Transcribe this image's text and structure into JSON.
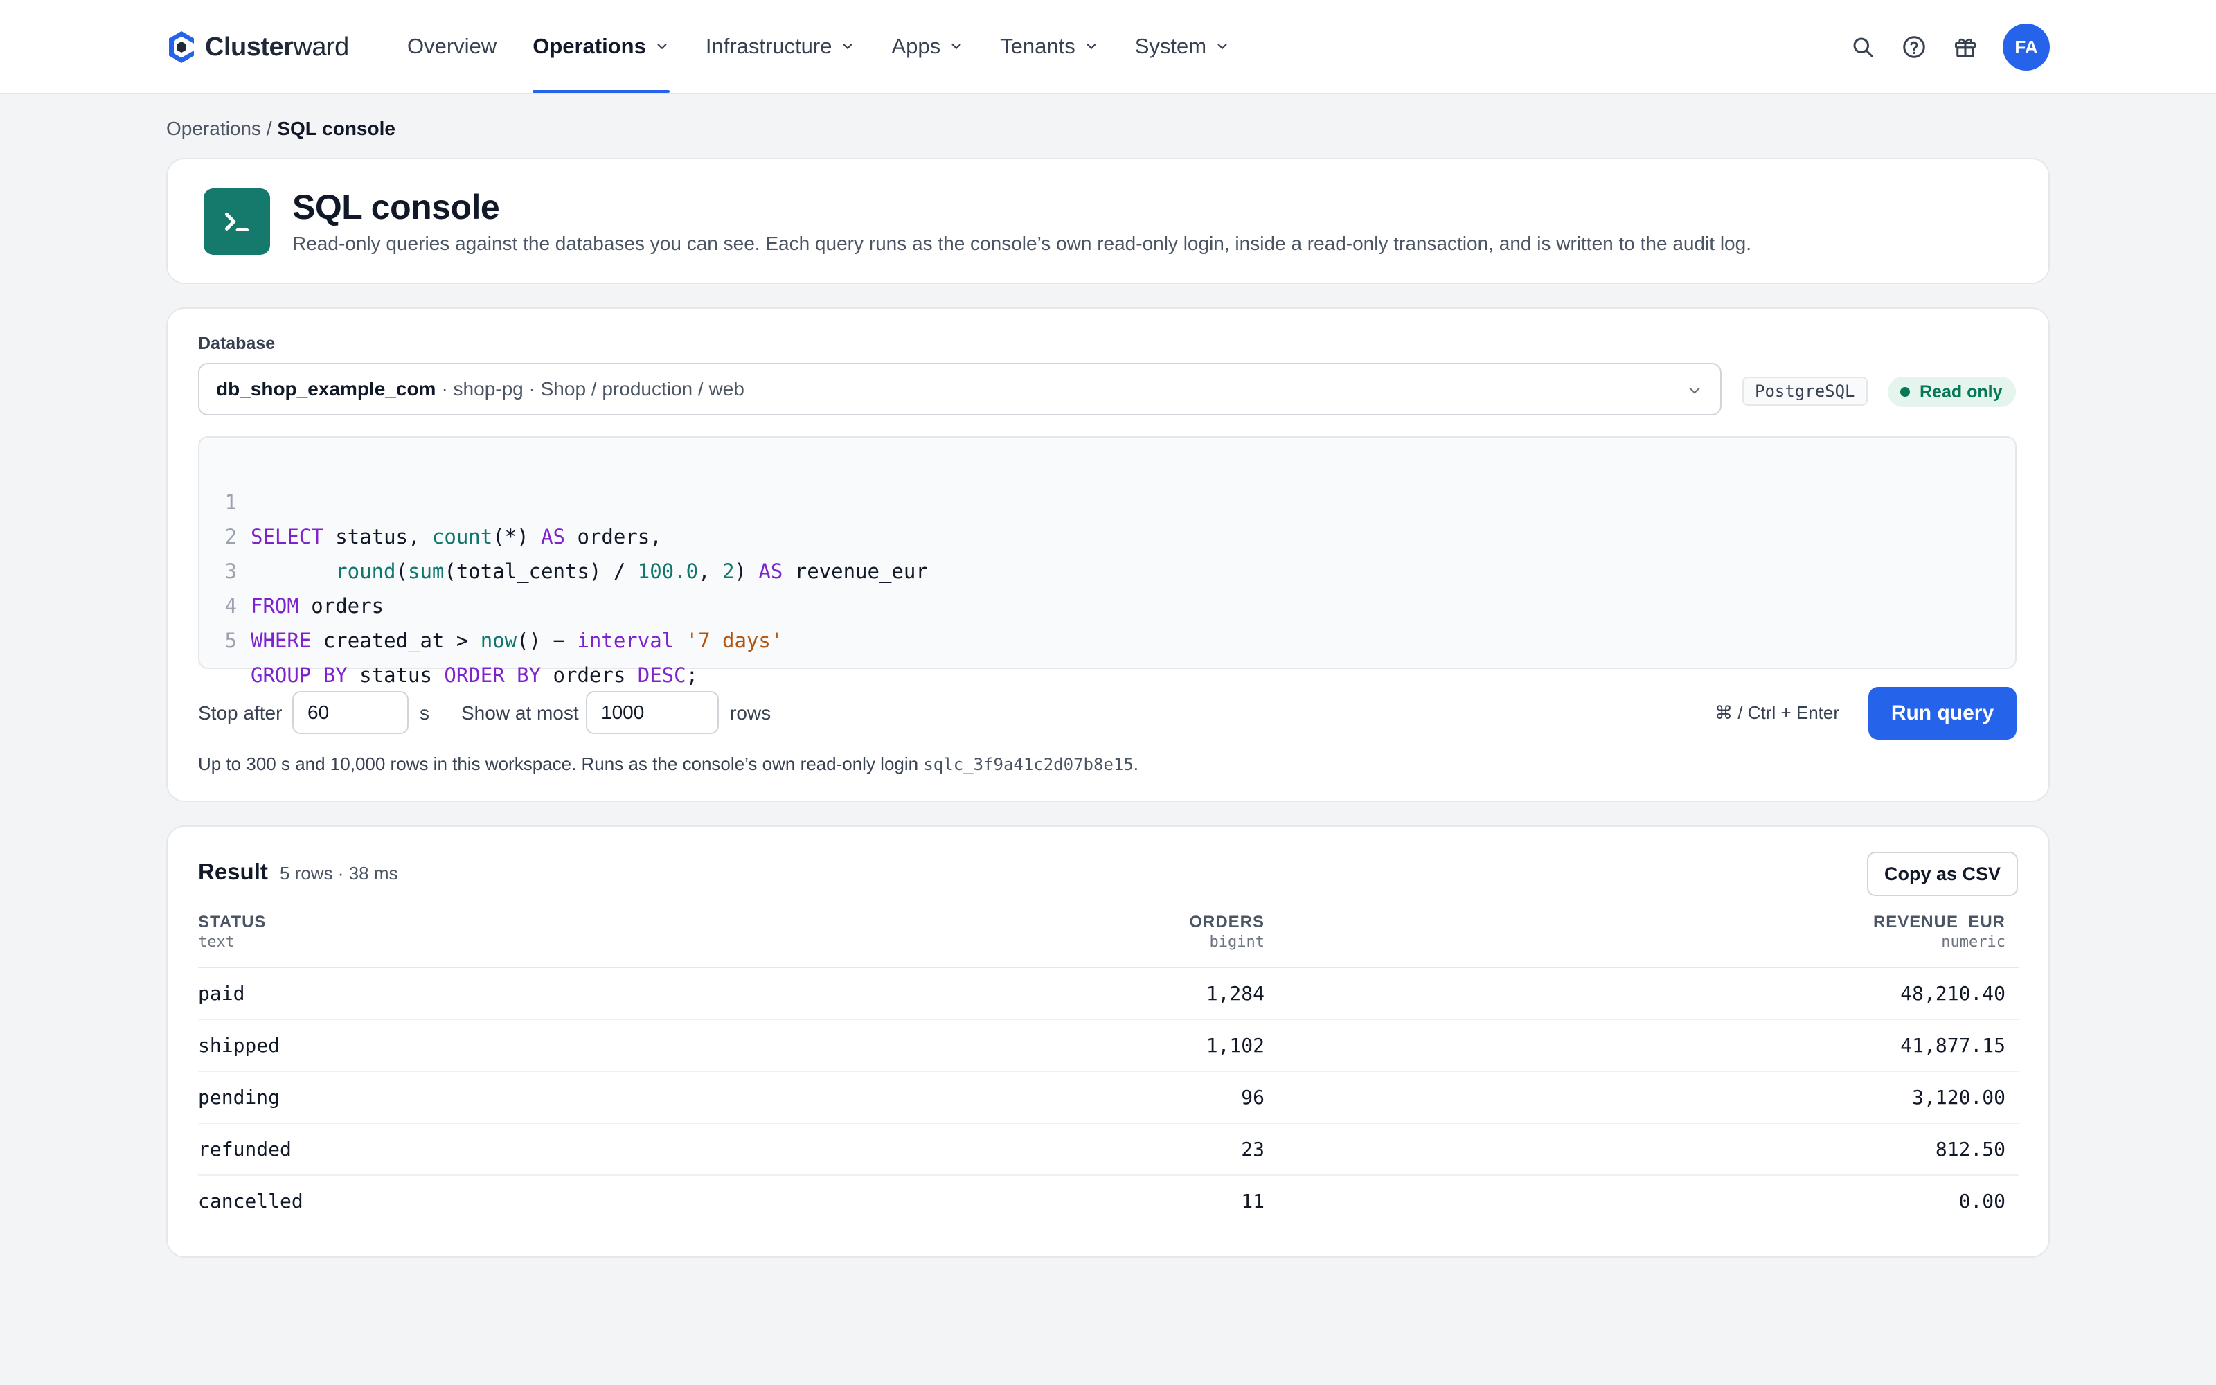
{
  "brand": {
    "name_bold": "Cluster",
    "name_light": "ward"
  },
  "nav": {
    "items": [
      {
        "label": "Overview"
      },
      {
        "label": "Operations"
      },
      {
        "label": "Infrastructure"
      },
      {
        "label": "Apps"
      },
      {
        "label": "Tenants"
      },
      {
        "label": "System"
      }
    ],
    "active": "Operations",
    "avatar_initials": "FA",
    "accent_color": "#2563eb"
  },
  "breadcrumb": {
    "parent": "Operations",
    "separator": " / ",
    "current": "SQL console"
  },
  "header": {
    "title": "SQL console",
    "description": "Read-only queries against the databases you can see. Each query runs as the console’s own read-only login, inside a read-only transaction, and is written to the audit log."
  },
  "query": {
    "database_label": "Database",
    "database_name": "db_shop_example_com",
    "database_meta": "· shop-pg · Shop / production / web",
    "engine_badge": "PostgreSQL",
    "mode_badge": "Read only",
    "code_lines": [
      "1",
      "2",
      "3",
      "4",
      "5"
    ],
    "stop_after_label": "Stop after",
    "stop_after_value": "60",
    "stop_after_unit": "s",
    "show_at_most_label": "Show at most",
    "show_at_most_value": "1000",
    "show_at_most_unit": "rows",
    "shortcut": "⌘ / Ctrl + Enter",
    "run_label": "Run query",
    "help_prefix": "Up to 300 s and 10,000 rows in this workspace. Runs as the console’s own read-only login ",
    "help_login": "sqlc_3f9a41c2d07b8e15",
    "help_suffix": "."
  },
  "result": {
    "title": "Result",
    "meta": "5 rows · 38 ms",
    "copy_label": "Copy as CSV",
    "columns": [
      {
        "name": "STATUS",
        "type": "text"
      },
      {
        "name": "ORDERS",
        "type": "bigint"
      },
      {
        "name": "REVENUE_EUR",
        "type": "numeric"
      }
    ],
    "rows": [
      [
        "paid",
        "1,284",
        "48,210.40"
      ],
      [
        "shipped",
        "1,102",
        "41,877.15"
      ],
      [
        "pending",
        "96",
        "3,120.00"
      ],
      [
        "refunded",
        "23",
        "812.50"
      ],
      [
        "cancelled",
        "11",
        "0.00"
      ]
    ]
  }
}
